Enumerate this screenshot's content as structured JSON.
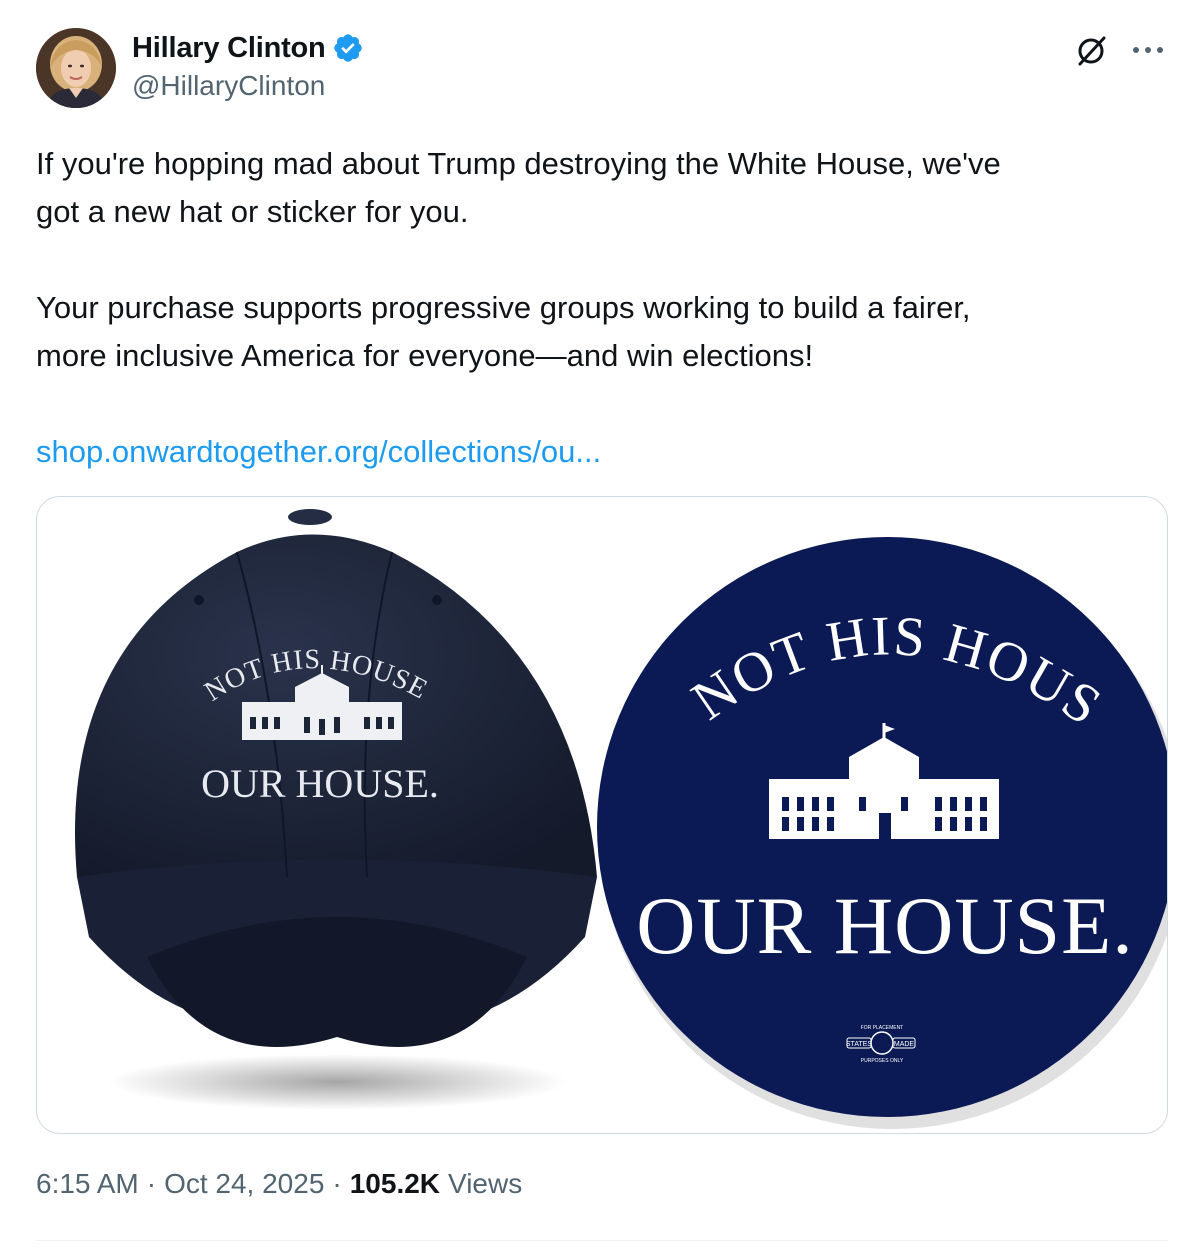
{
  "author": {
    "display_name": "Hillary Clinton",
    "handle": "@HillaryClinton",
    "verified": true,
    "verified_color": "#1d9bf0"
  },
  "tweet": {
    "lines_p1": [
      "If you're hopping mad about Trump destroying the White House, we've",
      "got a new hat or sticker for you."
    ],
    "lines_p2": [
      "Your purchase supports progressive groups working to build a fairer,",
      "more inclusive America for everyone—and win elections!"
    ],
    "link": "shop.onwardtogether.org/collections/ou..."
  },
  "media": {
    "hat": {
      "top_text": "NOT HIS HOUSE.",
      "bottom_text": "OUR HOUSE.",
      "color": "#1c2438"
    },
    "sticker": {
      "top_text": "NOT HIS HOUSE.",
      "bottom_text": "OUR HOUSE.",
      "color": "#0b1a55",
      "badge_left": "STATES",
      "badge_right": "MADE",
      "badge_top": "FOR PLACEMENT",
      "badge_bottom": "PURPOSES ONLY"
    }
  },
  "meta": {
    "time": "6:15 AM",
    "separator": "·",
    "date": "Oct 24, 2025",
    "views_count": "105.2K",
    "views_label": "Views"
  },
  "icons": {
    "grok": "grok-icon",
    "more": "more-icon",
    "verified": "verified-badge-icon"
  },
  "colors": {
    "link": "#1d9bf0",
    "secondary_text": "#536471",
    "border": "#cfd9de"
  }
}
